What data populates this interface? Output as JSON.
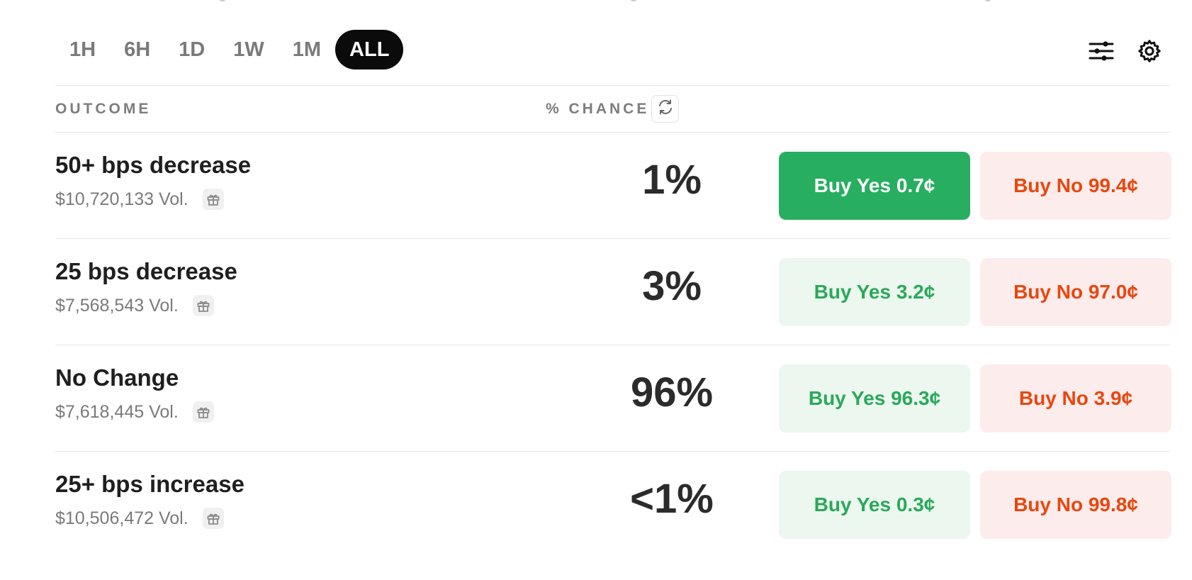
{
  "timeframes": [
    "1H",
    "6H",
    "1D",
    "1W",
    "1M",
    "ALL"
  ],
  "active_timeframe": "ALL",
  "icons": {
    "filter": "sliders-icon",
    "settings": "gear-icon",
    "refresh": "refresh-icon",
    "gift": "gift-icon"
  },
  "header": {
    "outcome": "OUTCOME",
    "chance": "% CHANCE"
  },
  "colors": {
    "yes_solid": "#27ae60",
    "yes_soft_bg": "#ecf7ef",
    "yes_text": "#2ba85a",
    "no_bg": "#fdecec",
    "no_text": "#e8470f"
  },
  "rows": [
    {
      "name": "50+ bps decrease",
      "volume": "$10,720,133 Vol.",
      "chance": "1%",
      "buy_yes": "Buy Yes 0.7¢",
      "buy_no": "Buy No 99.4¢"
    },
    {
      "name": "25 bps decrease",
      "volume": "$7,568,543 Vol.",
      "chance": "3%",
      "buy_yes": "Buy Yes 3.2¢",
      "buy_no": "Buy No 97.0¢"
    },
    {
      "name": "No Change",
      "volume": "$7,618,445 Vol.",
      "chance": "96%",
      "buy_yes": "Buy Yes 96.3¢",
      "buy_no": "Buy No 3.9¢"
    },
    {
      "name": "25+ bps increase",
      "volume": "$10,506,472 Vol.",
      "chance": "<1%",
      "buy_yes": "Buy Yes 0.3¢",
      "buy_no": "Buy No 99.8¢"
    }
  ]
}
